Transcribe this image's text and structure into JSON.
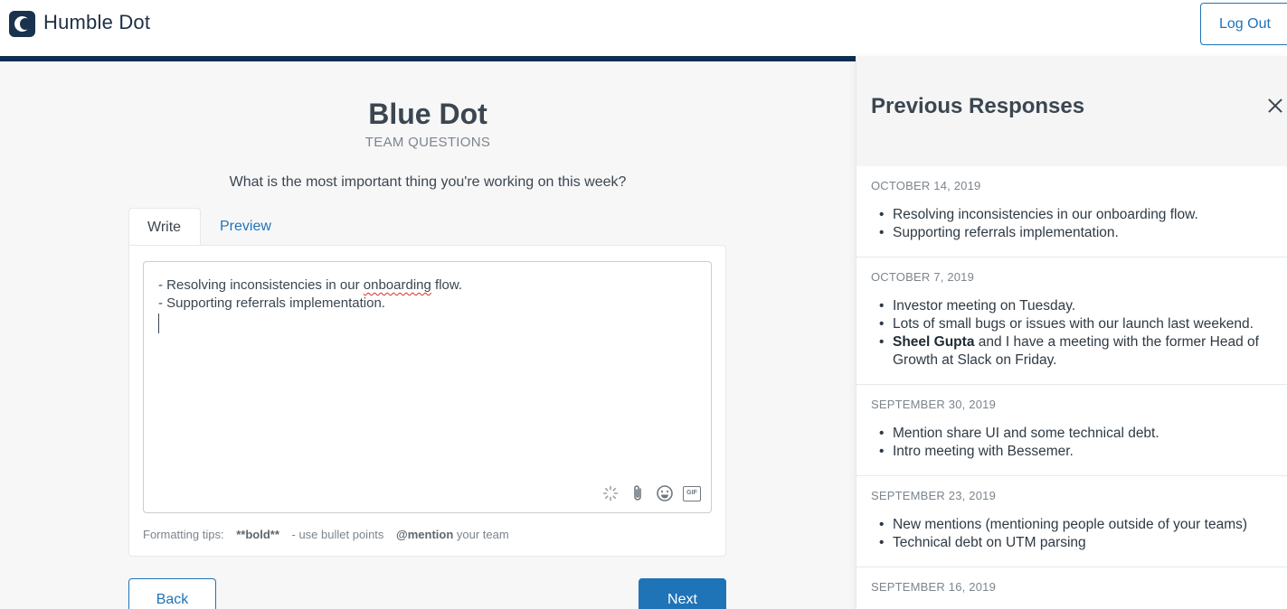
{
  "header": {
    "brand": "Humble Dot",
    "logout_label": "Log Out"
  },
  "progress": {
    "fraction": 0.673
  },
  "main": {
    "team_name": "Blue Dot",
    "section": "TEAM QUESTIONS",
    "question": "What is the most important thing you're working on this week?",
    "tabs": {
      "write": "Write",
      "preview": "Preview"
    },
    "editor": {
      "line1_prefix": "- Resolving inconsistencies in our ",
      "line1_misspelled": "onboarding",
      "line1_suffix": " flow.",
      "line2": "- Supporting referrals implementation."
    },
    "editor_icons": [
      "spinner-icon",
      "paperclip-icon",
      "smiley-icon",
      "gif-icon"
    ],
    "gif_label": "GIF",
    "tips": {
      "label": "Formatting tips:",
      "bold": "**bold**",
      "bullets": "- use bullet points",
      "mention_strong": "@mention",
      "mention_rest": " your team"
    },
    "back_label": "Back",
    "next_label": "Next"
  },
  "panel": {
    "title": "Previous Responses",
    "responses": [
      {
        "date": "OCTOBER 14, 2019",
        "items": [
          {
            "text": "Resolving inconsistencies in our onboarding flow."
          },
          {
            "text": "Supporting referrals implementation."
          }
        ]
      },
      {
        "date": "OCTOBER 7, 2019",
        "items": [
          {
            "text": "Investor meeting on Tuesday."
          },
          {
            "text": "Lots of small bugs or issues with our launch last weekend."
          },
          {
            "bold": "Sheel Gupta",
            "text": " and I have a meeting with the former Head of Growth at Slack on Friday."
          }
        ]
      },
      {
        "date": "SEPTEMBER 30, 2019",
        "items": [
          {
            "text": "Mention share UI and some technical debt."
          },
          {
            "text": "Intro meeting with Bessemer."
          }
        ]
      },
      {
        "date": "SEPTEMBER 23, 2019",
        "items": [
          {
            "text": "New mentions (mentioning people outside of your teams)"
          },
          {
            "text": "Technical debt on UTM parsing"
          }
        ]
      },
      {
        "date": "SEPTEMBER 16, 2019",
        "items": []
      }
    ]
  }
}
